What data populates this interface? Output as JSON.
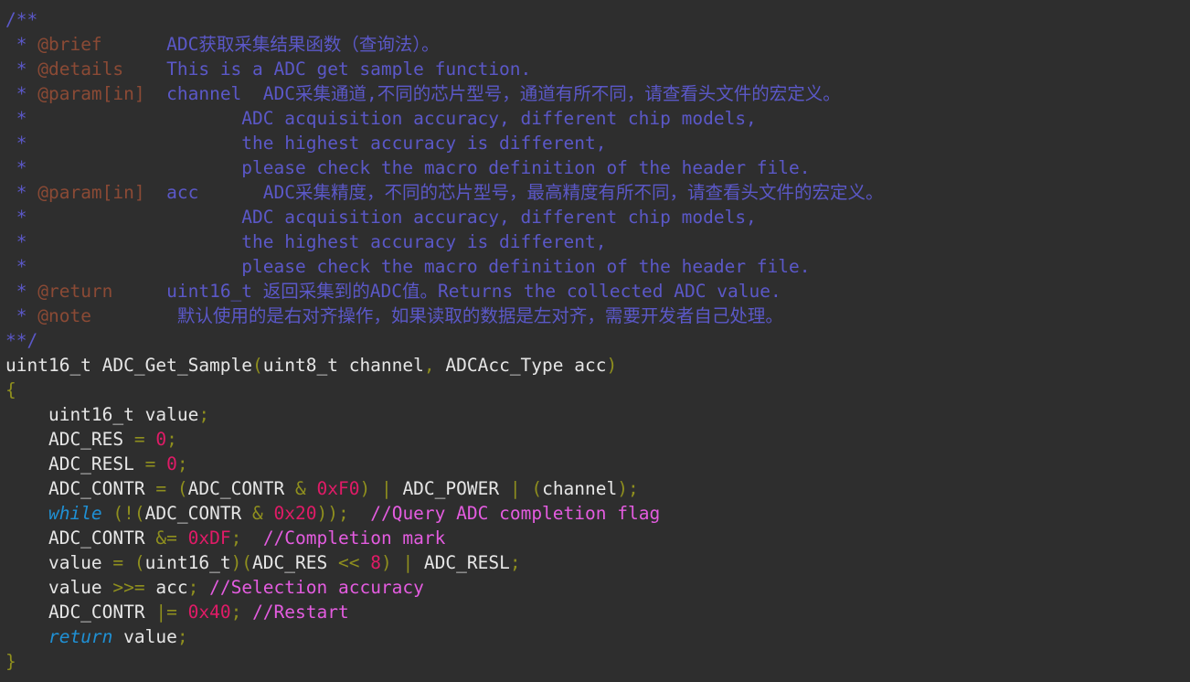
{
  "editor": {
    "language": "c",
    "background": "#2e2e2e",
    "colors": {
      "doc_comment": "#5b58c8",
      "doc_tag": "#8b4a35",
      "line_comment": "#e45ce0",
      "identifier": "#e6e6e6",
      "keyword": "#1f90d4",
      "number": "#e01b67",
      "operator": "#8f8f1e",
      "brace": "#8f8f1e"
    },
    "lines": [
      [
        {
          "t": "/**",
          "c": "c-doc"
        }
      ],
      [
        {
          "t": " * ",
          "c": "c-doc"
        },
        {
          "t": "@brief",
          "c": "c-tag"
        },
        {
          "t": "      ADC获取采集结果函数（查询法）。",
          "c": "c-doc"
        }
      ],
      [
        {
          "t": " * ",
          "c": "c-doc"
        },
        {
          "t": "@details",
          "c": "c-tag"
        },
        {
          "t": "    This is a ADC get sample function.",
          "c": "c-doc"
        }
      ],
      [
        {
          "t": " * ",
          "c": "c-doc"
        },
        {
          "t": "@param[in]",
          "c": "c-tag"
        },
        {
          "t": "  channel  ADC采集通道,不同的芯片型号，通道有所不同，请查看头文件的宏定义。",
          "c": "c-doc"
        }
      ],
      [
        {
          "t": " *                    ADC acquisition accuracy, different chip models,",
          "c": "c-doc"
        }
      ],
      [
        {
          "t": " *                    the highest accuracy is different,",
          "c": "c-doc"
        }
      ],
      [
        {
          "t": " *                    please check the macro definition of the header file.",
          "c": "c-doc"
        }
      ],
      [
        {
          "t": " * ",
          "c": "c-doc"
        },
        {
          "t": "@param[in]",
          "c": "c-tag"
        },
        {
          "t": "  acc      ADC采集精度，不同的芯片型号，最高精度有所不同，请查看头文件的宏定义。",
          "c": "c-doc"
        }
      ],
      [
        {
          "t": " *                    ADC acquisition accuracy, different chip models,",
          "c": "c-doc"
        }
      ],
      [
        {
          "t": " *                    the highest accuracy is different,",
          "c": "c-doc"
        }
      ],
      [
        {
          "t": " *                    please check the macro definition of the header file.",
          "c": "c-doc"
        }
      ],
      [
        {
          "t": " * ",
          "c": "c-doc"
        },
        {
          "t": "@return",
          "c": "c-tag"
        },
        {
          "t": "     uint16_t 返回采集到的ADC值。Returns the collected ADC value.",
          "c": "c-doc"
        }
      ],
      [
        {
          "t": " * ",
          "c": "c-doc"
        },
        {
          "t": "@note",
          "c": "c-tag"
        },
        {
          "t": "        默认使用的是右对齐操作，如果读取的数据是左对齐，需要开发者自己处理。",
          "c": "c-doc"
        }
      ],
      [
        {
          "t": "**/",
          "c": "c-doc"
        }
      ],
      [
        {
          "t": "uint16_t ADC_Get_Sample",
          "c": "c-ident"
        },
        {
          "t": "(",
          "c": "c-op"
        },
        {
          "t": "uint8_t channel",
          "c": "c-ident"
        },
        {
          "t": ",",
          "c": "c-op"
        },
        {
          "t": " ADCAcc_Type acc",
          "c": "c-ident"
        },
        {
          "t": ")",
          "c": "c-op"
        }
      ],
      [
        {
          "t": "{",
          "c": "c-brace"
        }
      ],
      [
        {
          "t": "    uint16_t value",
          "c": "c-ident"
        },
        {
          "t": ";",
          "c": "c-op"
        }
      ],
      [
        {
          "t": "    ADC_RES ",
          "c": "c-ident"
        },
        {
          "t": "= ",
          "c": "c-op"
        },
        {
          "t": "0",
          "c": "c-num"
        },
        {
          "t": ";",
          "c": "c-op"
        }
      ],
      [
        {
          "t": "    ADC_RESL ",
          "c": "c-ident"
        },
        {
          "t": "= ",
          "c": "c-op"
        },
        {
          "t": "0",
          "c": "c-num"
        },
        {
          "t": ";",
          "c": "c-op"
        }
      ],
      [
        {
          "t": "    ADC_CONTR ",
          "c": "c-ident"
        },
        {
          "t": "= (",
          "c": "c-op"
        },
        {
          "t": "ADC_CONTR ",
          "c": "c-ident"
        },
        {
          "t": "& ",
          "c": "c-op"
        },
        {
          "t": "0xF0",
          "c": "c-num"
        },
        {
          "t": ") ",
          "c": "c-op"
        },
        {
          "t": "| ",
          "c": "c-op"
        },
        {
          "t": "ADC_POWER ",
          "c": "c-ident"
        },
        {
          "t": "| (",
          "c": "c-op"
        },
        {
          "t": "channel",
          "c": "c-ident"
        },
        {
          "t": ");",
          "c": "c-op"
        }
      ],
      [
        {
          "t": "    ",
          "c": "c-ident"
        },
        {
          "t": "while",
          "c": "c-kw"
        },
        {
          "t": " (!(",
          "c": "c-op"
        },
        {
          "t": "ADC_CONTR ",
          "c": "c-ident"
        },
        {
          "t": "& ",
          "c": "c-op"
        },
        {
          "t": "0x20",
          "c": "c-num"
        },
        {
          "t": "));",
          "c": "c-op"
        },
        {
          "t": "  ",
          "c": "c-ident"
        },
        {
          "t": "//Query ADC completion flag",
          "c": "c-line"
        }
      ],
      [
        {
          "t": "    ADC_CONTR ",
          "c": "c-ident"
        },
        {
          "t": "&= ",
          "c": "c-op"
        },
        {
          "t": "0xDF",
          "c": "c-num"
        },
        {
          "t": ";",
          "c": "c-op"
        },
        {
          "t": "  ",
          "c": "c-ident"
        },
        {
          "t": "//Completion mark",
          "c": "c-line"
        }
      ],
      [
        {
          "t": "    value ",
          "c": "c-ident"
        },
        {
          "t": "= (",
          "c": "c-op"
        },
        {
          "t": "uint16_t",
          "c": "c-ident"
        },
        {
          "t": ")(",
          "c": "c-op"
        },
        {
          "t": "ADC_RES ",
          "c": "c-ident"
        },
        {
          "t": "<< ",
          "c": "c-op"
        },
        {
          "t": "8",
          "c": "c-num"
        },
        {
          "t": ") ",
          "c": "c-op"
        },
        {
          "t": "| ",
          "c": "c-op"
        },
        {
          "t": "ADC_RESL",
          "c": "c-ident"
        },
        {
          "t": ";",
          "c": "c-op"
        }
      ],
      [
        {
          "t": "    value ",
          "c": "c-ident"
        },
        {
          "t": ">>= ",
          "c": "c-op"
        },
        {
          "t": "acc",
          "c": "c-ident"
        },
        {
          "t": "; ",
          "c": "c-op"
        },
        {
          "t": "//Selection accuracy",
          "c": "c-line"
        }
      ],
      [
        {
          "t": "    ADC_CONTR ",
          "c": "c-ident"
        },
        {
          "t": "|= ",
          "c": "c-op"
        },
        {
          "t": "0x40",
          "c": "c-num"
        },
        {
          "t": "; ",
          "c": "c-op"
        },
        {
          "t": "//Restart",
          "c": "c-line"
        }
      ],
      [
        {
          "t": "    ",
          "c": "c-ident"
        },
        {
          "t": "return",
          "c": "c-kw"
        },
        {
          "t": " value",
          "c": "c-ident"
        },
        {
          "t": ";",
          "c": "c-op"
        }
      ],
      [
        {
          "t": "}",
          "c": "c-brace"
        }
      ]
    ]
  }
}
